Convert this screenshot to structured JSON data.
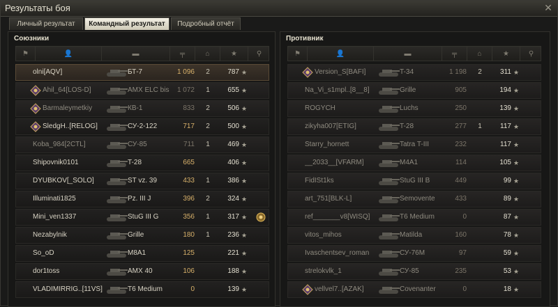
{
  "window": {
    "title": "Результаты боя",
    "close_icon": "close-icon"
  },
  "tabs": [
    {
      "label": "Личный результат",
      "active": false
    },
    {
      "label": "Командный результат",
      "active": true
    },
    {
      "label": "Подробный отчёт",
      "active": false
    }
  ],
  "allies": {
    "title": "Союзники",
    "header_icons": [
      "squad-icon",
      "player-icon",
      "tank-icon",
      "damage-icon",
      "kills-icon",
      "sort-chevron-icon",
      "xp-star-icon",
      "medal-icon"
    ],
    "rows": [
      {
        "name": "olni[AQV]",
        "tank": "БТ-7",
        "damage": "1 096",
        "kills": "2",
        "xp": "787",
        "status": "me",
        "badge": ""
      },
      {
        "name": "Ahil_64[LOS-D]",
        "tank": "AMX ELC bis",
        "damage": "1 072",
        "kills": "1",
        "xp": "655",
        "status": "dead",
        "badge": "clan"
      },
      {
        "name": "Barmaleymetkiy",
        "tank": "КВ-1",
        "damage": "833",
        "kills": "2",
        "xp": "506",
        "status": "dead",
        "badge": "clan"
      },
      {
        "name": "SledgH..[RELOG]",
        "tank": "СУ-2-122",
        "damage": "717",
        "kills": "2",
        "xp": "500",
        "status": "alive",
        "badge": "clan"
      },
      {
        "name": "Koba_984[2CTL]",
        "tank": "СУ-85",
        "damage": "711",
        "kills": "1",
        "xp": "469",
        "status": "dead",
        "badge": ""
      },
      {
        "name": "Shipovnik0101",
        "tank": "T-28",
        "damage": "665",
        "kills": "",
        "xp": "406",
        "status": "alive",
        "badge": ""
      },
      {
        "name": "DYUBKOV[_SOLO]",
        "tank": "ST vz. 39",
        "damage": "433",
        "kills": "1",
        "xp": "386",
        "status": "alive",
        "badge": ""
      },
      {
        "name": "Illuminati1825",
        "tank": "Pz. III J",
        "damage": "396",
        "kills": "2",
        "xp": "324",
        "status": "alive",
        "badge": ""
      },
      {
        "name": "Mini_ven1337",
        "tank": "StuG III G",
        "damage": "356",
        "kills": "1",
        "xp": "317",
        "status": "alive",
        "badge": "",
        "medal": true
      },
      {
        "name": "Nezabylnik",
        "tank": "Grille",
        "damage": "180",
        "kills": "1",
        "xp": "236",
        "status": "alive",
        "badge": ""
      },
      {
        "name": "So_oD",
        "tank": "M8A1",
        "damage": "125",
        "kills": "",
        "xp": "221",
        "status": "alive",
        "badge": ""
      },
      {
        "name": "dor1toss",
        "tank": "AMX 40",
        "damage": "106",
        "kills": "",
        "xp": "188",
        "status": "alive",
        "badge": ""
      },
      {
        "name": "VLADIMIRRIG..[11VS]",
        "tank": "T6 Medium",
        "damage": "0",
        "kills": "",
        "xp": "139",
        "status": "alive",
        "badge": ""
      }
    ]
  },
  "enemies": {
    "title": "Противник",
    "rows": [
      {
        "name": "Version_S[BAFI]",
        "tank": "T-34",
        "damage": "1 198",
        "kills": "2",
        "xp": "311",
        "status": "dead",
        "badge": "clan"
      },
      {
        "name": "Na_Vi_s1mpl..[8__8]",
        "tank": "Grille",
        "damage": "905",
        "kills": "",
        "xp": "194",
        "status": "dead",
        "badge": ""
      },
      {
        "name": "ROGYCH",
        "tank": "Luchs",
        "damage": "250",
        "kills": "",
        "xp": "139",
        "status": "dead",
        "badge": ""
      },
      {
        "name": "zikyha007[ETIG]",
        "tank": "T-28",
        "damage": "277",
        "kills": "1",
        "xp": "117",
        "status": "dead",
        "badge": ""
      },
      {
        "name": "Starry_hornett",
        "tank": "Tatra T-III",
        "damage": "232",
        "kills": "",
        "xp": "117",
        "status": "dead",
        "badge": ""
      },
      {
        "name": "__2033__[VFARM]",
        "tank": "M4A1",
        "damage": "114",
        "kills": "",
        "xp": "105",
        "status": "dead",
        "badge": ""
      },
      {
        "name": "FidISt1ks",
        "tank": "StuG III B",
        "damage": "449",
        "kills": "",
        "xp": "99",
        "status": "dead",
        "badge": ""
      },
      {
        "name": "art_751[BLK-L]",
        "tank": "Semovente",
        "damage": "433",
        "kills": "",
        "xp": "89",
        "status": "dead",
        "badge": ""
      },
      {
        "name": "ref_______v8[WISQ]",
        "tank": "T6 Medium",
        "damage": "0",
        "kills": "",
        "xp": "87",
        "status": "dead",
        "badge": ""
      },
      {
        "name": "vitos_mihos",
        "tank": "Matilda",
        "damage": "160",
        "kills": "",
        "xp": "78",
        "status": "dead",
        "badge": ""
      },
      {
        "name": "Ivaschentsev_roman",
        "tank": "СУ-76М",
        "damage": "97",
        "kills": "",
        "xp": "59",
        "status": "dead",
        "badge": ""
      },
      {
        "name": "strelokvlk_1",
        "tank": "СУ-85",
        "damage": "235",
        "kills": "",
        "xp": "53",
        "status": "dead",
        "badge": ""
      },
      {
        "name": "vellvel7..[AZAK]",
        "tank": "Covenanter",
        "damage": "0",
        "kills": "",
        "xp": "18",
        "status": "dead",
        "badge": "clan"
      }
    ]
  },
  "colors": {
    "me_row": "#3d342a",
    "damage": "#d7b06a",
    "text": "#d8d3c4",
    "dead_text": "#8e8a7f"
  }
}
